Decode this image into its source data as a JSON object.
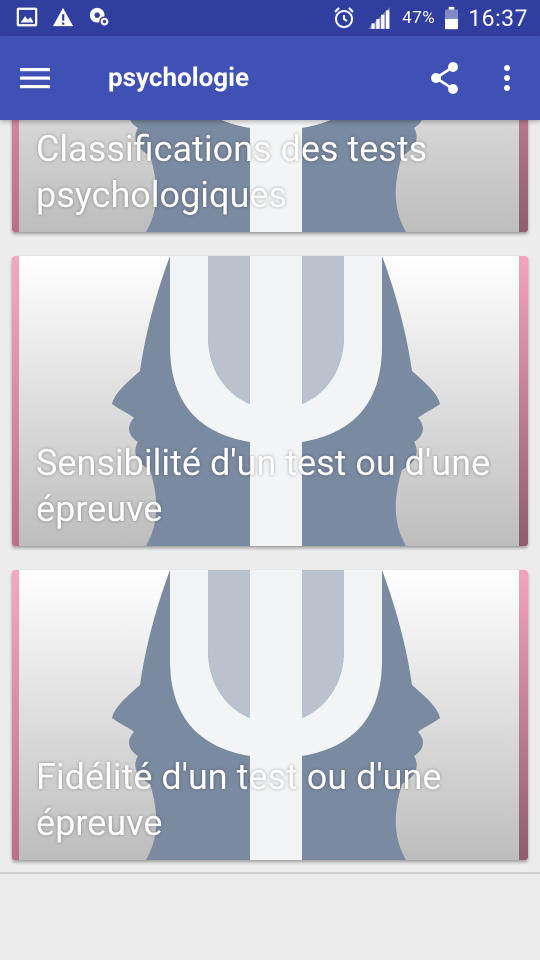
{
  "status_bar": {
    "battery_percent": "47%",
    "time": "16:37"
  },
  "app_bar": {
    "title": "psychologie"
  },
  "cards": [
    {
      "title": "Classifications des tests psychologiques"
    },
    {
      "title": "Sensibilité d'un test ou d'une épreuve"
    },
    {
      "title": "Fidélité d'un test ou d'une épreuve"
    }
  ],
  "colors": {
    "status_bar": "#303f9f",
    "app_bar": "#3f51b5",
    "card_accent": "#f6a7c2",
    "background": "#ececec"
  }
}
